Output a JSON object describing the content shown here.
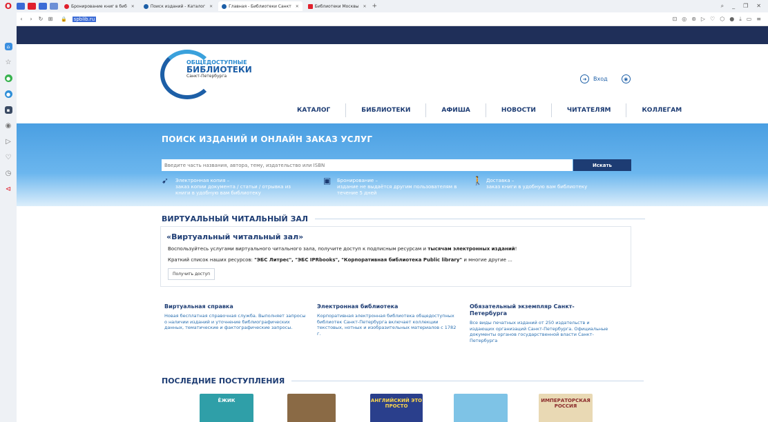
{
  "browser": {
    "tabs": [
      {
        "label": "Бронирование книг в биб",
        "active": false,
        "color": "#e0202d"
      },
      {
        "label": "Поиск изданий - Каталог",
        "active": false,
        "color": "#1d5fa7"
      },
      {
        "label": "Главная - Библиотеки Санкт",
        "active": true,
        "color": "#1d5fa7"
      },
      {
        "label": "Библиотеки Москвы",
        "active": false,
        "color": "#e0202d"
      }
    ],
    "url": "spblib.ru"
  },
  "site": {
    "logo": {
      "line1": "ОБЩЕДОСТУПНЫЕ",
      "line2": "БИБЛИОТЕКИ",
      "line3": "Санкт-Петербурга"
    },
    "login": "Вход",
    "nav": [
      "КАТАЛОГ",
      "БИБЛИОТЕКИ",
      "АФИША",
      "НОВОСТИ",
      "ЧИТАТЕЛЯМ",
      "КОЛЛЕГАМ"
    ],
    "hero": {
      "title": "ПОИСК ИЗДАНИЙ И ОНЛАЙН ЗАКАЗ УСЛУГ",
      "search_placeholder": "Введите часть названия, автора, тему, издательство или ISBN",
      "search_button": "Искать",
      "services": [
        {
          "title": "Электронная копия –",
          "text1": "заказ копии документа / статьи / отрывка из",
          "text2": "книги в удобную вам библиотеку"
        },
        {
          "title": "Бронирование –",
          "text1": "издание не выдаётся другим пользователям в",
          "text2": "течение 5 дней"
        },
        {
          "title": "Доставка –",
          "text1": "заказ книги в удобную вам библиотеку",
          "text2": ""
        }
      ]
    },
    "virtual": {
      "section": "ВИРТУАЛЬНЫЙ ЧИТАЛЬНЫЙ ЗАЛ",
      "heading": "«Виртуальный читальный зал»",
      "text1a": "Воспользуйтесь услугами виртуального читального зала, получите доступ к подписным ресурсам и ",
      "text1b": "тысячам электронных изданий",
      "text1c": "!",
      "text2a": "Краткий список наших ресурсов: ",
      "text2b": "\"ЭБС Литрес\", \"ЭБС IPRbooks\", \"Корпоративная библиотека Public library\"",
      "text2c": " и многие другие ...",
      "button": "Получить доступ"
    },
    "columns": [
      {
        "title": "Виртуальная справка",
        "text": "Новая бесплатная справочная служба. Выполняет запросы о наличии изданий и уточнение библиографических данных, тематические и фактографические запросы."
      },
      {
        "title": "Электронная библиотека",
        "text": "Корпоративная электронная библиотека общедоступных библиотек Санкт-Петербурга включает коллекции текстовых, нотных и изобразительных материалов с 1782 г."
      },
      {
        "title": "Обязательный экземпляр Санкт-Петербурга",
        "text": "Все виды печатных изданий от 250 издательств и издающих организаций Санкт-Петербурга. Официальные документы органов государственной власти Санкт-Петербурга"
      }
    ],
    "latest": {
      "section": "ПОСЛЕДНИЕ ПОСТУПЛЕНИЯ",
      "books": [
        {
          "label": "ЁЖИК",
          "color": "#2f9fa8"
        },
        {
          "label": "",
          "color": "#8a6a45"
        },
        {
          "label": "АНГЛИЙСКИЙ ЭТО ПРОСТО",
          "color": "#2a3f8c"
        },
        {
          "label": "",
          "color": "#7ec3e6"
        },
        {
          "label": "ИМПЕРАТОРСКАЯ РОССИЯ",
          "color": "#e9d9b4"
        }
      ]
    }
  }
}
